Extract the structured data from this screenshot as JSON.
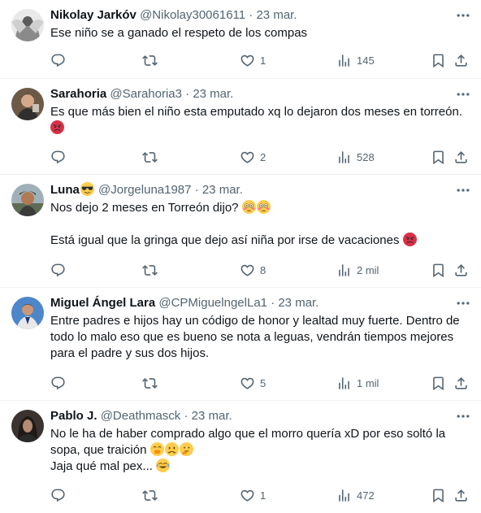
{
  "tweets": [
    {
      "name": "Nikolay Jarkóv",
      "handle": "@Nikolay30061611",
      "sep": "·",
      "date": "23 mar.",
      "lines": [
        "Ese niño se a ganado el respeto de los compas"
      ],
      "emojis": [],
      "replies": "",
      "retweets": "",
      "likes": "1",
      "views": "145"
    },
    {
      "name": "Sarahoria",
      "handle": "@Sarahoria3",
      "sep": "·",
      "date": "23 mar.",
      "lines": [
        "Es que más bien el niño esta emputado xq lo dejaron dos meses en torreón."
      ],
      "emojis": [
        "angry-face-emoji"
      ],
      "replies": "",
      "retweets": "",
      "likes": "2",
      "views": "528"
    },
    {
      "name": "Luna",
      "name_emoji": "sunglasses-emoji",
      "handle": "@Jorgeluna1987",
      "sep": "·",
      "date": "23 mar.",
      "lines": [
        "Nos dejo 2 meses en Torreón dijo?",
        "",
        "Está igual que la gringa que dejo así niña por irse de vacaciones"
      ],
      "emojis": [
        "flushed-face-emoji",
        "flushed-face-emoji",
        "angry-face-emoji"
      ],
      "replies": "",
      "retweets": "",
      "likes": "8",
      "views": "2 mil"
    },
    {
      "name": "Miguel Ángel Lara",
      "handle": "@CPMiguelngelLa1",
      "sep": "·",
      "date": "23 mar.",
      "lines": [
        "Entre padres e hijos hay un código de honor y lealtad muy fuerte. Dentro de todo lo malo eso que es bueno se nota a leguas, vendrán tiempos mejores para el padre y sus dos hijos."
      ],
      "emojis": [],
      "replies": "",
      "retweets": "",
      "likes": "5",
      "views": "1 mil"
    },
    {
      "name": "Pablo J.",
      "handle": "@Deathmasck",
      "sep": "·",
      "date": "23 mar.",
      "lines": [
        "No le ha de haber comprado algo que el morro quería xD por eso soltó la sopa, que traición",
        "Jaja qué mal pex..."
      ],
      "emojis": [
        "hand-over-mouth-emoji",
        "worried-face-emoji",
        "thinking-face-emoji",
        "tears-of-joy-emoji"
      ],
      "replies": "",
      "retweets": "",
      "likes": "1",
      "views": "472"
    }
  ],
  "colors": {
    "text": "#0f1419",
    "secondary": "#536471",
    "divider": "#eff3f4"
  }
}
